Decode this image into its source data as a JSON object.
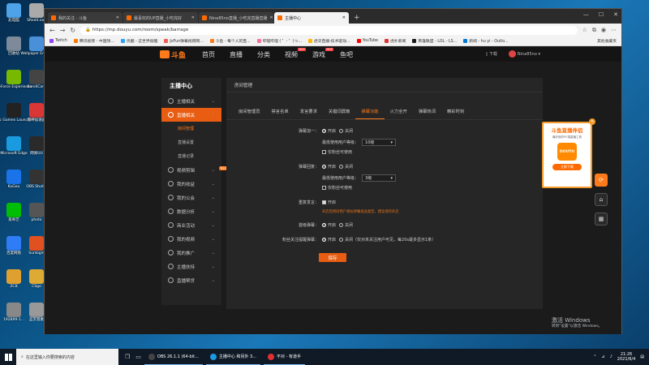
{
  "desktop": {
    "icons": [
      {
        "label": "此电脑",
        "color": "#4ea3e8"
      },
      {
        "label": "回收站",
        "color": "#7c8a99"
      },
      {
        "label": "GeForce Experience",
        "color": "#76b900"
      },
      {
        "label": "Epic Games Launcher",
        "color": "#222222"
      },
      {
        "label": "Microsoft Edge",
        "color": "#1a9be0"
      },
      {
        "label": "KuGou",
        "color": "#1a73e8"
      },
      {
        "label": "爱奇艺",
        "color": "#00be06"
      },
      {
        "label": "百度网盘",
        "color": "#2e7cf6"
      },
      {
        "label": "ZCB",
        "color": "#e0a030"
      },
      {
        "label": "192899-1...",
        "color": "#888888"
      },
      {
        "label": "SRedit.exe",
        "color": "#aaaaaa"
      },
      {
        "label": "Wallpaper Engine",
        "color": "#4a90d9"
      },
      {
        "label": "BandiCam",
        "color": "#444444"
      },
      {
        "label": "雷神加速器",
        "color": "#d93636"
      },
      {
        "label": "网易UU",
        "color": "#2a2a2a"
      },
      {
        "label": "OBS Studio",
        "color": "#333333"
      },
      {
        "label": "photo",
        "color": "#555555"
      },
      {
        "label": "Sunlogin",
        "color": "#e05020"
      },
      {
        "label": "CSgo",
        "color": "#ddaa33"
      },
      {
        "label": "蓝芙蓉素",
        "color": "#999999"
      }
    ]
  },
  "browser": {
    "tabs": [
      {
        "title": "我的关注 - 斗鱼",
        "active": false
      },
      {
        "title": "最喜欢的UP直播_小吃完好",
        "active": false
      },
      {
        "title": "Nine85no直播_小吃完直播直播",
        "active": false
      },
      {
        "title": "主播中心",
        "active": true
      }
    ],
    "url": "https://mp.douyu.com/room/speak/barrage",
    "bookmarks": [
      {
        "label": "Twitch",
        "color": "#9146ff"
      },
      {
        "label": "腾讯视频 - 中国领...",
        "color": "#ff7a00"
      },
      {
        "label": "优酷 - 这世界很酷",
        "color": "#2aa2f5"
      },
      {
        "label": "JoFun弹幕视频网...",
        "color": "#f25c54"
      },
      {
        "label": "斗鱼 - 每个人的直...",
        "color": "#ff7a1a"
      },
      {
        "label": "哔哩哔哩 ( ゜- ゜)つ...",
        "color": "#fb7299"
      },
      {
        "label": "虎牙直播-技术驱动...",
        "color": "#ffb800"
      },
      {
        "label": "YouTube",
        "color": "#ff0000"
      },
      {
        "label": "虎扑新闻",
        "color": "#d33"
      },
      {
        "label": "英雄联盟 - LOL - LS...",
        "color": "#1a1a1a"
      },
      {
        "label": "新闻 - hu yi - Outlo...",
        "color": "#0078d4"
      }
    ],
    "other_favorites": "其他收藏夹"
  },
  "site": {
    "logo": "斗鱼",
    "nav": [
      "首页",
      "直播",
      "分类",
      "视频",
      "游戏",
      "鱼吧"
    ],
    "nav_hot": "HOT",
    "download": "下载",
    "username": "Nine85no"
  },
  "sidebar": {
    "title": "主播中心",
    "items": [
      {
        "label": "主播相关",
        "kind": "group"
      },
      {
        "label": "直播相关",
        "kind": "active"
      },
      {
        "label": "房间管理",
        "kind": "sub-current"
      },
      {
        "label": "直播设置",
        "kind": "sub"
      },
      {
        "label": "直播记录",
        "kind": "sub"
      },
      {
        "label": "视频剪辑",
        "kind": "group",
        "badge": "NEW"
      },
      {
        "label": "我的收益",
        "kind": "group"
      },
      {
        "label": "我的公会",
        "kind": "group"
      },
      {
        "label": "数据分析",
        "kind": "group"
      },
      {
        "label": "商业活动",
        "kind": "group"
      },
      {
        "label": "我的视频",
        "kind": "group"
      },
      {
        "label": "我的推广",
        "kind": "group"
      },
      {
        "label": "主播扶持",
        "kind": "group"
      },
      {
        "label": "直播帮贷",
        "kind": "group"
      }
    ]
  },
  "main": {
    "header": "房间管理",
    "subtabs": [
      "房间管理员",
      "禁言名单",
      "发言要求",
      "关键词屏蔽",
      "弹幕功能",
      "火力全开",
      "弹幕热词",
      "精彩时刻"
    ],
    "active_subtab": 4,
    "form": {
      "barrage_plus": {
        "label": "弹幕加一：",
        "on": "开启",
        "off": "关闭",
        "level_label": "最低使用用户等级：",
        "level": "10级",
        "fans_only": "仅粉丝可使用"
      },
      "barrage_reply": {
        "label": "弹幕回复：",
        "on": "开启",
        "off": "关闭",
        "level_label": "最低使用用户等级：",
        "level": "3级",
        "fans_only": "仅粉丝可使用"
      },
      "repeat_speak": {
        "label": "重复发言：",
        "enabled": "开启",
        "hint": "开启后将同用户相似弹幕发送类型，建议保持开启"
      },
      "first_barrage": {
        "label": "首级弹幕：",
        "on": "开启",
        "off": "关闭"
      },
      "fans_follow_barrage": {
        "label": "粉丝关注提醒弹幕：",
        "on": "开启",
        "off": "关闭（仅对未关注用户可见，每20s最多显示1条）"
      },
      "save": "保存"
    }
  },
  "ad": {
    "title": "斗鱼直播伴侣",
    "subtitle": "最好用的PC端直播工具",
    "logo": "DOUYU",
    "button": "立即下载",
    "close": "×"
  },
  "watermark": {
    "line1": "激活 Windows",
    "line2": "转到“设置”以激活 Windows。"
  },
  "taskbar": {
    "search": "在这里输入你要搜索的内容",
    "apps": [
      {
        "label": "OBS 26.1.1 (64-bit...",
        "color": "#444444"
      },
      {
        "label": "主播中心 和另外 3...",
        "color": "#1a9be0"
      },
      {
        "label": "不对 - 有道手",
        "color": "#e03030"
      }
    ],
    "time": "21:26",
    "date": "2021/6/4"
  }
}
